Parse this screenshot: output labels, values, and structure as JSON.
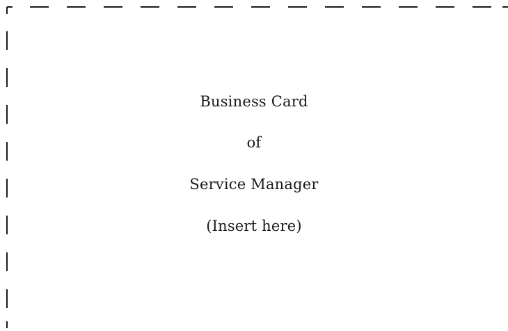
{
  "placeholder": {
    "lines": [
      "Business Card",
      "of",
      "Service Manager",
      "(Insert here)"
    ]
  },
  "colors": {
    "border": "#1a1a1a",
    "text": "#1a1a1a",
    "background": "#ffffff"
  }
}
